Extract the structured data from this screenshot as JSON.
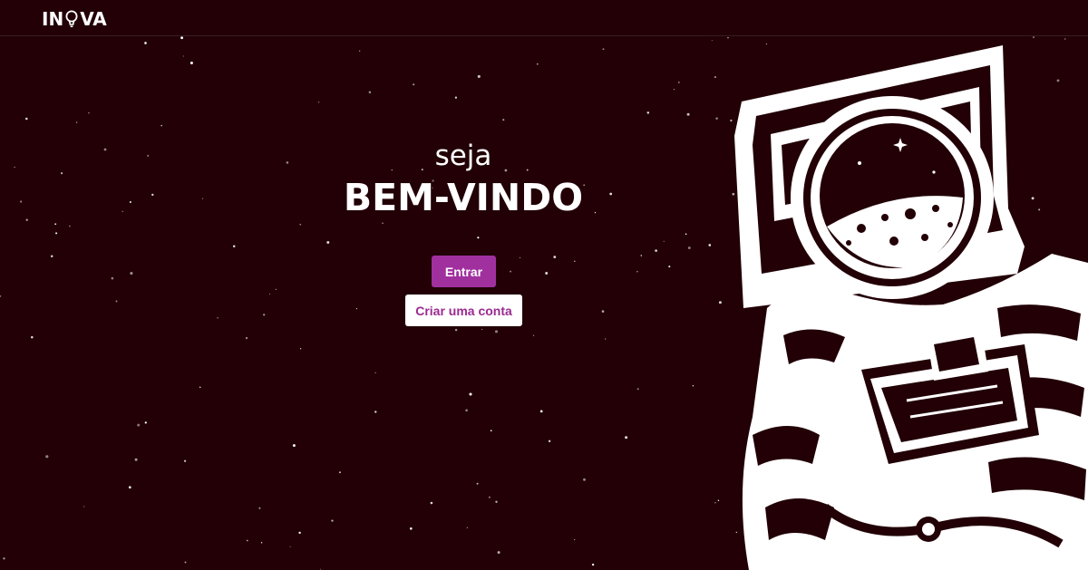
{
  "header": {
    "logo_left": "IN",
    "logo_right": "VA",
    "logo_icon": "lightbulb-icon"
  },
  "hero": {
    "kicker": "seja",
    "title": "BEM-VINDO"
  },
  "actions": {
    "login_label": "Entrar",
    "signup_label": "Criar uma conta"
  },
  "illustration": {
    "icon": "astronaut-illustration"
  },
  "colors": {
    "background": "#220006",
    "primary": "#a1309f",
    "primary_text": "#ffffff",
    "secondary_bg": "#ffffff",
    "secondary_text": "#9a2a91"
  }
}
